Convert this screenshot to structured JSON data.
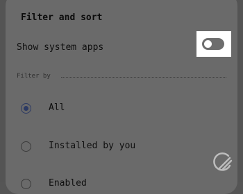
{
  "dialog": {
    "title": "Filter and sort",
    "system_apps": {
      "label": "Show system apps",
      "enabled": false
    },
    "filter_section": {
      "label": "Filter by",
      "options": [
        {
          "label": "All",
          "selected": true
        },
        {
          "label": "Installed by you",
          "selected": false
        },
        {
          "label": "Enabled",
          "selected": false
        }
      ]
    }
  },
  "colors": {
    "scrim": "#545454",
    "dialog_bg": "#6a6a6a",
    "accent": "#2c3a63",
    "toggle_highlight": "#ffffff"
  }
}
